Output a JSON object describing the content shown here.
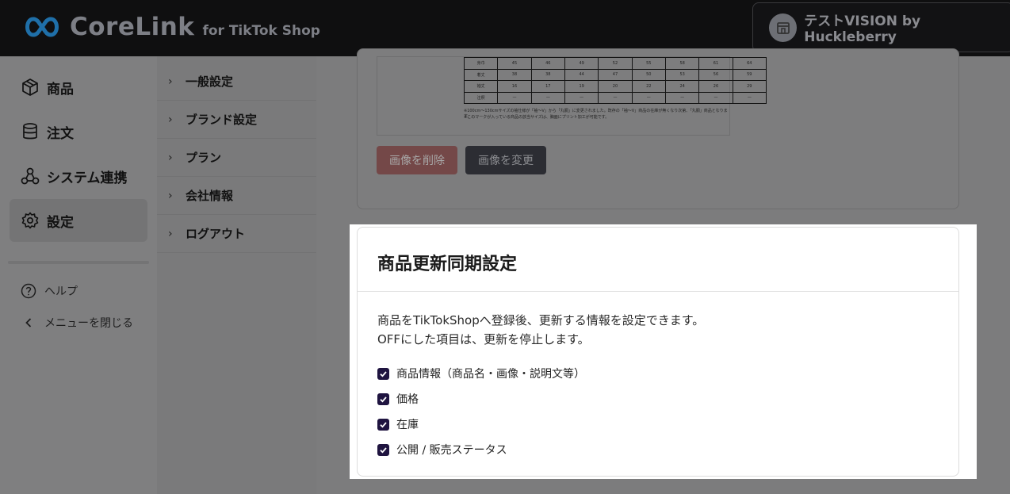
{
  "header": {
    "logo_text": "CoreLink",
    "logo_sub": "for TikTok Shop",
    "shop_name": "テストVISION by Huckleberry"
  },
  "sidebar": {
    "items": [
      {
        "label": "商品",
        "icon": "box-icon"
      },
      {
        "label": "注文",
        "icon": "database-icon"
      },
      {
        "label": "システム連携",
        "icon": "network-icon"
      },
      {
        "label": "設定",
        "icon": "gear-icon",
        "active": true
      }
    ],
    "help_label": "ヘルプ",
    "close_menu_label": "メニューを閉じる"
  },
  "subnav": {
    "items": [
      "一般設定",
      "ブランド設定",
      "プラン",
      "会社情報",
      "ログアウト"
    ]
  },
  "content": {
    "size_table_rows": [
      [
        "身巾",
        "45",
        "46",
        "49",
        "52",
        "55",
        "58",
        "61",
        "64"
      ],
      [
        "着丈",
        "38",
        "38",
        "44",
        "47",
        "50",
        "53",
        "56",
        "59"
      ],
      [
        "袖丈",
        "16",
        "17",
        "19",
        "20",
        "22",
        "24",
        "26",
        "29"
      ],
      [
        "注釈",
        "—",
        "—",
        "—",
        "—",
        "—",
        "—",
        "—",
        "—"
      ]
    ],
    "note_line_1": "※100cm〜130cmサイズの袖仕様が「袖〜V」から「丸胴」に変更されました。既存の「袖〜V」商品の在庫が無くなり次第、「丸胴」商品となります。",
    "note_line_2": "※このマークが入っている商品の該当サイズは、胸面にプリント加工が可能です。",
    "delete_image_label": "画像を削除",
    "change_image_label": "画像を変更"
  },
  "modal": {
    "title": "商品更新同期設定",
    "desc_line_1": "商品をTikTokShopへ登録後、更新する情報を設定できます。",
    "desc_line_2": "OFFにした項目は、更新を停止します。",
    "options": [
      {
        "label": "商品情報（商品名・画像・説明文等）",
        "checked": true
      },
      {
        "label": "価格",
        "checked": true
      },
      {
        "label": "在庫",
        "checked": true
      },
      {
        "label": "公開 / 販売ステータス",
        "checked": true
      }
    ]
  },
  "colors": {
    "topbar": "#0f0f10",
    "checkbox": "#1f1440",
    "delete_button": "#744848",
    "change_button": "#2c2d33"
  }
}
